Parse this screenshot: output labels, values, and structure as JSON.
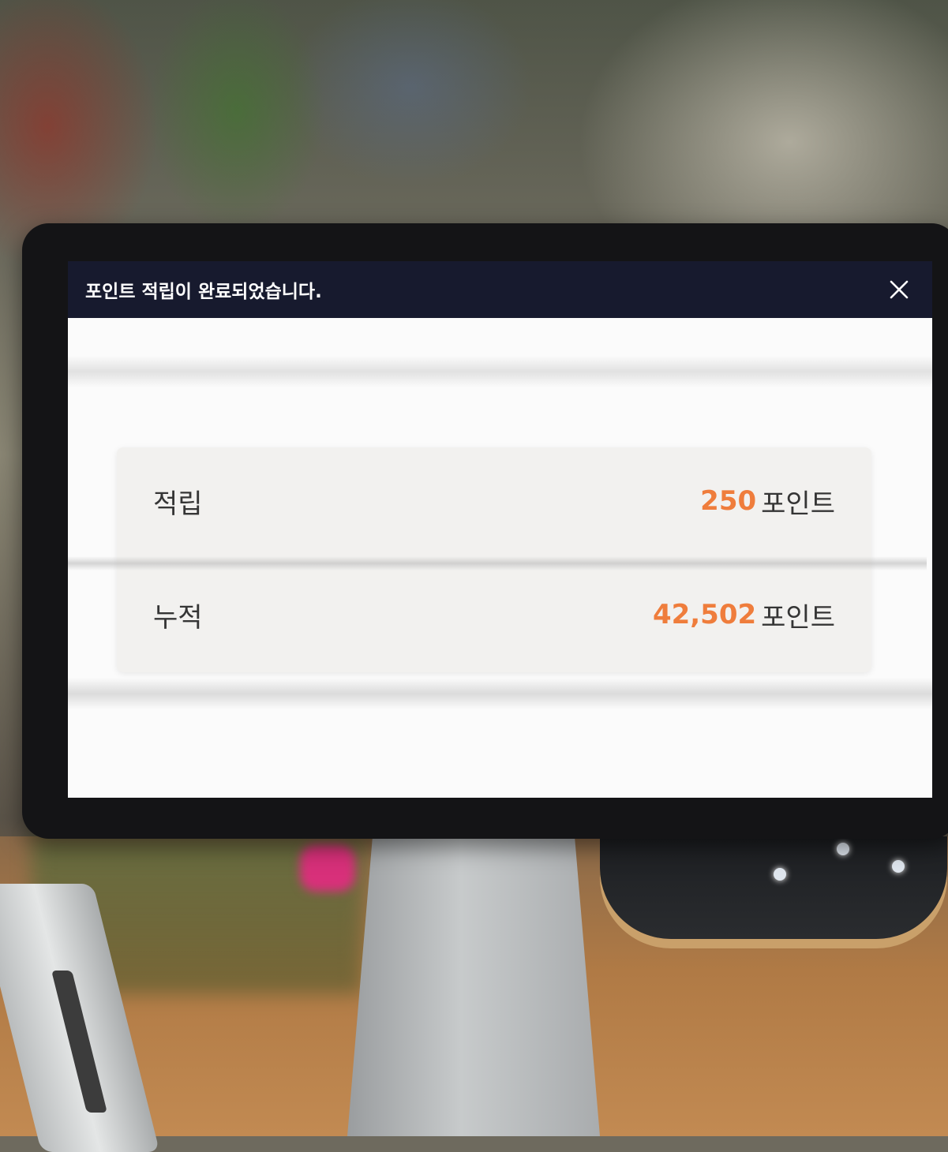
{
  "dialog": {
    "title": "포인트 적립이 완료되었습니다.",
    "close_icon": "close-icon"
  },
  "points": {
    "rows": [
      {
        "label": "적립",
        "value": "250",
        "unit": "포인트"
      },
      {
        "label": "누적",
        "value": "42,502",
        "unit": "포인트"
      }
    ],
    "accent_color": "#ef7d3c"
  },
  "colors": {
    "titlebar": "#171a2e",
    "screen": "#fbfbfb"
  }
}
